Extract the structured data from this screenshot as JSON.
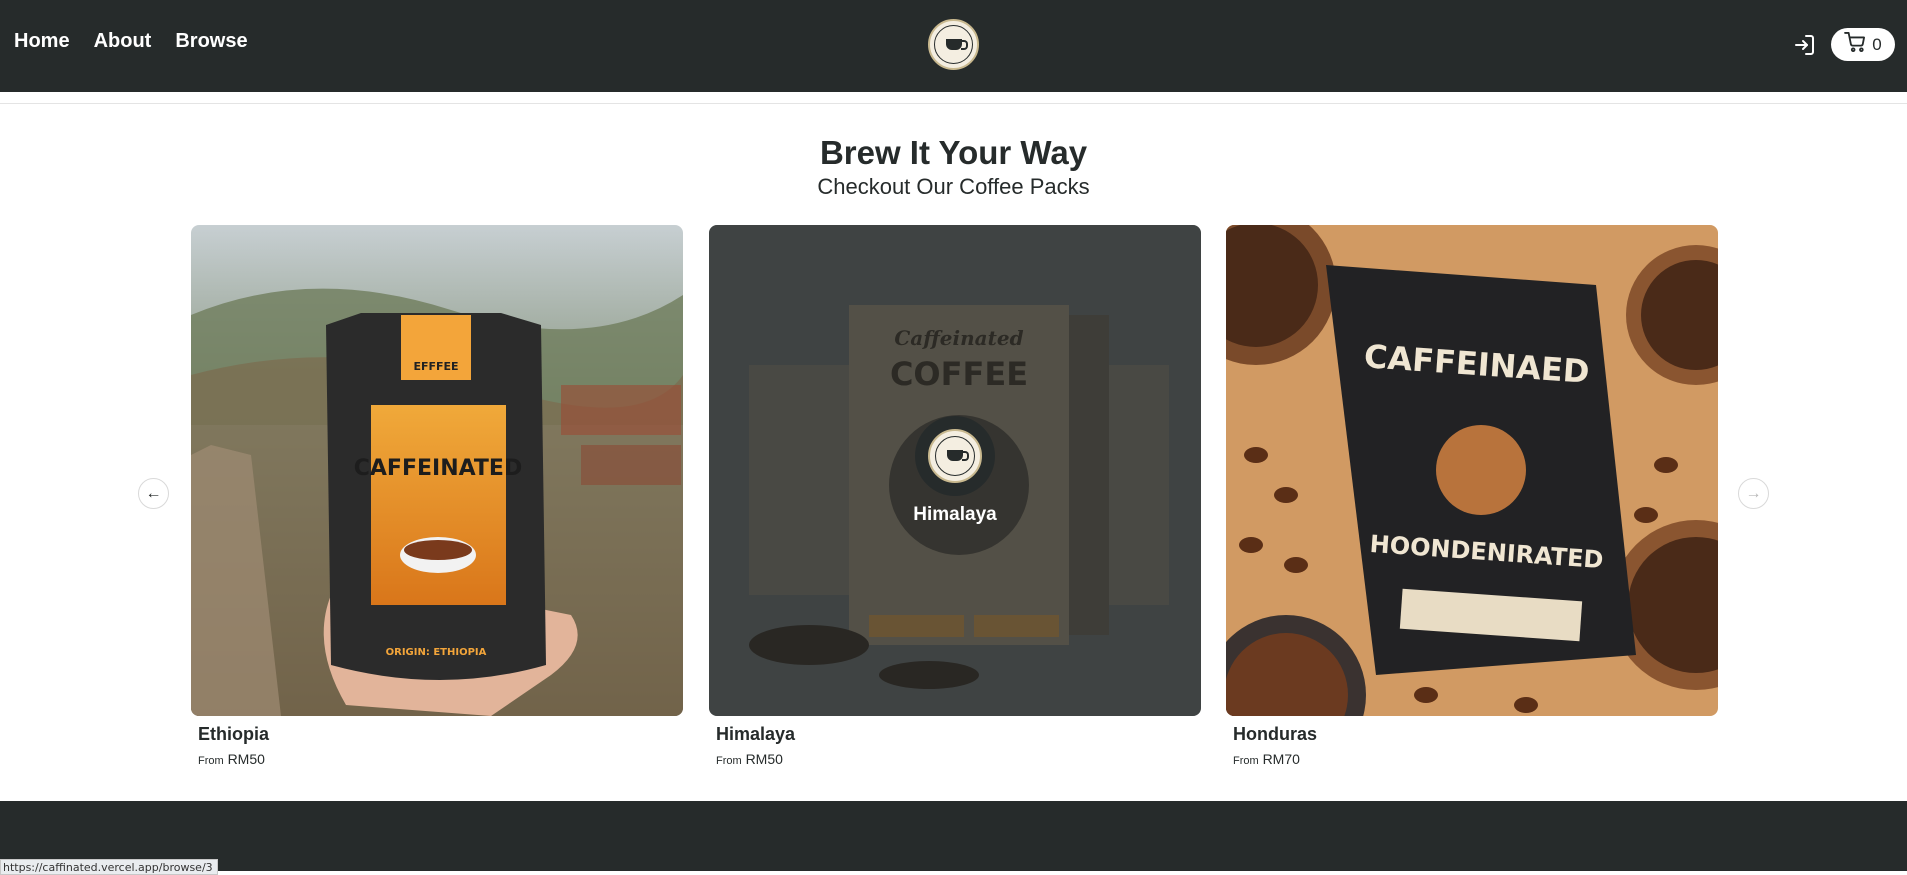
{
  "header": {
    "nav": [
      "Home",
      "About",
      "Browse"
    ],
    "logo_icon": "vintage-caffeine-logo",
    "login_icon": "login-icon",
    "cart_icon": "cart-icon",
    "cart_count": "0"
  },
  "hero": {
    "title": "Brew It Your Way",
    "subtitle": "Checkout Our Coffee Packs"
  },
  "carousel": {
    "prev_icon": "arrow-left-icon",
    "next_icon": "arrow-right-icon",
    "products": [
      {
        "name": "Ethiopia",
        "price_prefix": "From",
        "price": "RM50"
      },
      {
        "name": "Himalaya",
        "price_prefix": "From",
        "price": "RM50",
        "hover_label": "Himalaya"
      },
      {
        "name": "Honduras",
        "price_prefix": "From",
        "price": "RM70"
      }
    ]
  },
  "status_bar": {
    "url": "https://caffinated.vercel.app/browse/3"
  },
  "colors": {
    "dark": "#262b2b",
    "background": "#ffffff",
    "accent": "#e8a23a"
  }
}
